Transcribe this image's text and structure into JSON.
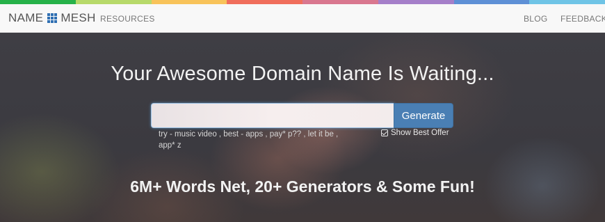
{
  "strip_colors": [
    "#27b24a",
    "#b7d96a",
    "#f8c35a",
    "#f06e5c",
    "#d9778f",
    "#a57fc9",
    "#5e90d6",
    "#6fc4e6"
  ],
  "nav": {
    "brand_left": "NAME",
    "brand_right": "MESH",
    "resources": "RESOURCES",
    "blog": "BLOG",
    "feedback": "FEEDBACK"
  },
  "hero": {
    "headline": "Your Awesome Domain Name Is Waiting...",
    "search": {
      "value": "",
      "placeholder": ""
    },
    "generate_label": "Generate",
    "hints": "try - music video , best - apps , pay* p?? , let it be , app* z",
    "offer_label": "Show Best Offer",
    "tagline": "6M+ Words Net, 20+ Generators & Some Fun!"
  }
}
